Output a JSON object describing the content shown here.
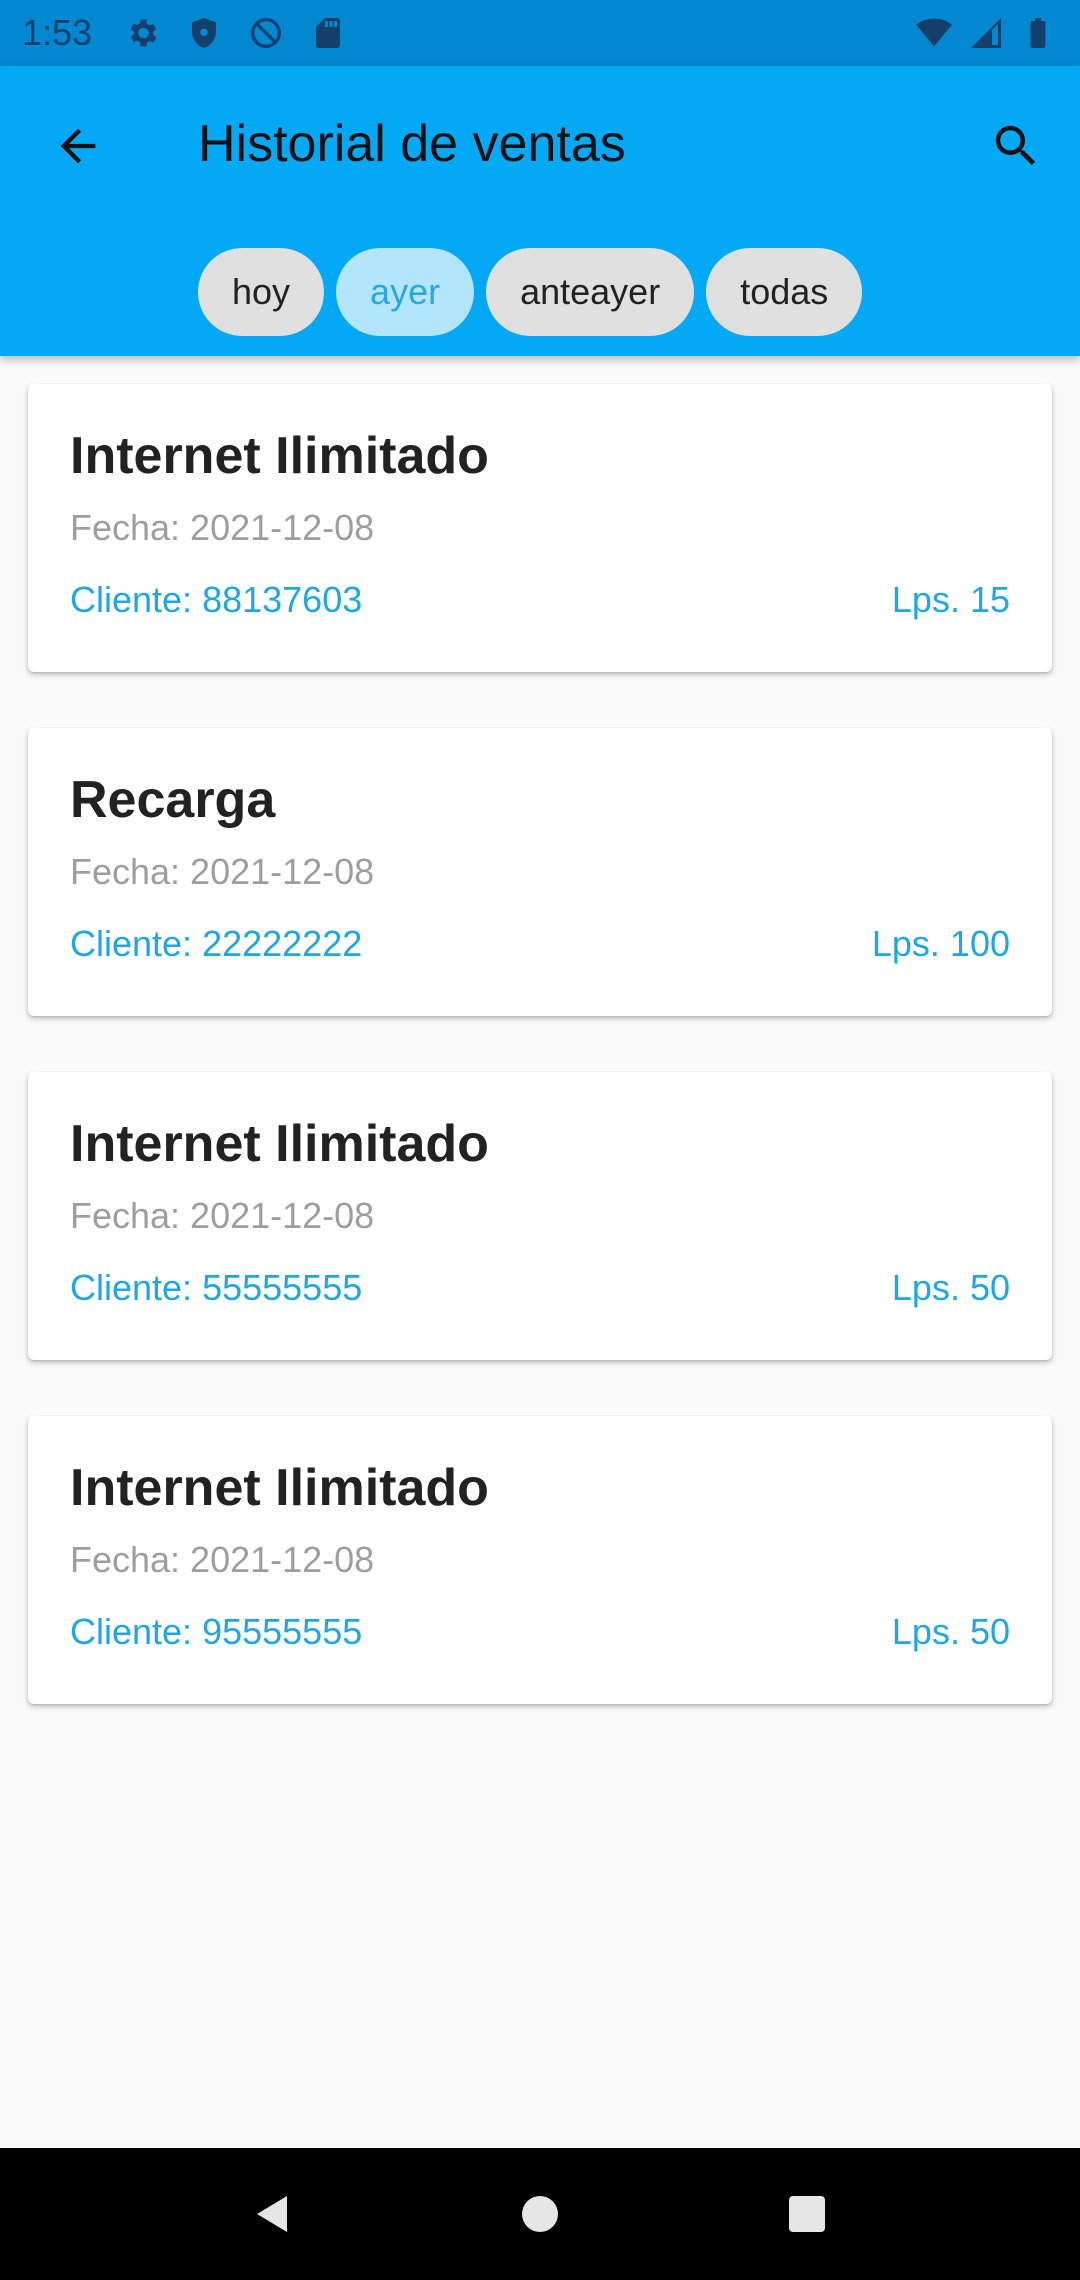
{
  "status_bar": {
    "time": "1:53",
    "left_icons": [
      "gear-icon",
      "shield-icon",
      "at-sign-icon",
      "sd-card-icon"
    ],
    "right_icons": [
      "wifi-icon",
      "cell-signal-icon",
      "battery-icon"
    ]
  },
  "app_bar": {
    "title": "Historial de ventas",
    "back_icon": "arrow-back-icon",
    "search_icon": "search-icon",
    "background_color": "#03a9f4"
  },
  "filters": {
    "chips": [
      {
        "label": "hoy",
        "selected": false
      },
      {
        "label": "ayer",
        "selected": true
      },
      {
        "label": "anteayer",
        "selected": false
      },
      {
        "label": "todas",
        "selected": false
      }
    ]
  },
  "sales": [
    {
      "product": "Internet Ilimitado",
      "date": "Fecha: 2021-12-08",
      "client": "Cliente: 88137603",
      "amount": "Lps. 15"
    },
    {
      "product": "Recarga",
      "date": "Fecha: 2021-12-08",
      "client": "Cliente: 22222222",
      "amount": "Lps. 100"
    },
    {
      "product": "Internet Ilimitado",
      "date": "Fecha: 2021-12-08",
      "client": "Cliente: 55555555",
      "amount": "Lps. 50"
    },
    {
      "product": "Internet Ilimitado",
      "date": "Fecha: 2021-12-08",
      "client": "Cliente: 95555555",
      "amount": "Lps. 50"
    }
  ],
  "nav_bar": {
    "buttons": [
      "back-triangle-icon",
      "home-circle-icon",
      "recents-square-icon"
    ]
  }
}
